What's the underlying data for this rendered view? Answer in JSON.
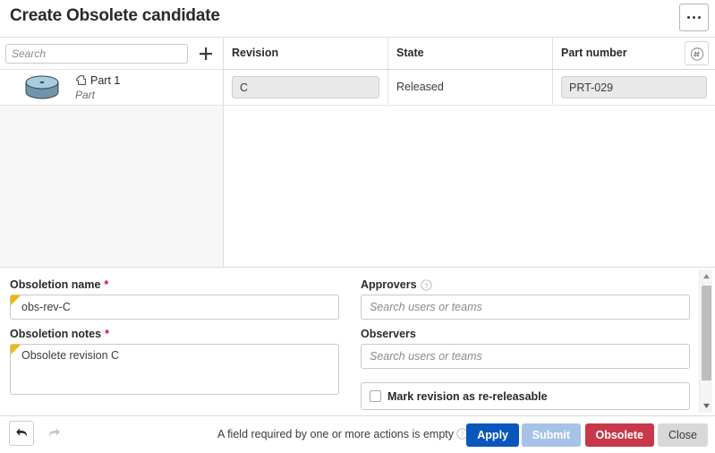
{
  "header": {
    "title": "Create Obsolete candidate",
    "overflow_menu_icon": "ellipsis-icon"
  },
  "tree": {
    "search": {
      "placeholder": "Search",
      "value": ""
    },
    "add_icon": "plus-icon",
    "items": [
      {
        "name": "Part 1",
        "type": "Part",
        "thumbnail_icon": "part-cylinder-thumbnail",
        "badge_icon": "part-icon"
      }
    ]
  },
  "table": {
    "columns": [
      {
        "label": "Revision"
      },
      {
        "label": "State"
      },
      {
        "label": "Part number"
      }
    ],
    "regenerate_icon": "regenerate-number-icon",
    "rows": [
      {
        "revision": "C",
        "state": "Released",
        "part_number": "PRT-029"
      }
    ]
  },
  "form": {
    "obsoletion_name": {
      "label": "Obsoletion name",
      "required_marker": "*",
      "value": "obs-rev-C",
      "placeholder": ""
    },
    "obsoletion_notes": {
      "label": "Obsoletion notes",
      "required_marker": "*",
      "value": "Obsolete revision C",
      "placeholder": ""
    },
    "approvers": {
      "label": "Approvers",
      "help_icon": "question-icon",
      "value": "",
      "placeholder": "Search users or teams"
    },
    "observers": {
      "label": "Observers",
      "value": "",
      "placeholder": "Search users or teams"
    },
    "re_releasable": {
      "label": "Mark revision as re-releasable",
      "checked": false
    }
  },
  "scrollbar": {
    "up_icon": "caret-up-icon",
    "down_icon": "caret-down-icon"
  },
  "footer": {
    "undo_icon": "undo-arrow-icon",
    "redo_icon": "redo-arrow-icon",
    "status_message": "A field required by one or more actions is empty",
    "status_help_icon": "question-icon",
    "buttons": {
      "apply": "Apply",
      "submit": "Submit",
      "obsolete": "Obsolete",
      "close": "Close"
    }
  },
  "colors": {
    "apply_blue": "#0b56bd",
    "submit_blue_disabled": "#a6c2e6",
    "obsolete_red": "#c8384a",
    "close_grey": "#d8d8d8",
    "required_red": "#c8102e",
    "modified_flag_yellow": "#f2b705"
  }
}
